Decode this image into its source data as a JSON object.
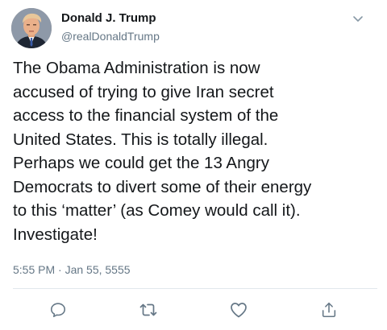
{
  "author": {
    "display_name": "Donald J. Trump",
    "handle": "@realDonaldTrump",
    "avatar_icon": "profile-photo"
  },
  "tweet": {
    "text": "The Obama Administration is now\naccused of trying to give Iran secret\naccess to the financial system of the\nUnited States. This is totally illegal.\nPerhaps we could get the 13 Angry\nDemocrats to divert some of their energy\nto this ‘matter’ (as Comey would call it).\nInvestigate!",
    "timestamp": "5:55 PM · Jan 55, 5555"
  },
  "actions": [
    {
      "name": "reply",
      "icon": "speech-bubble-icon"
    },
    {
      "name": "retweet",
      "icon": "retweet-arrows-icon"
    },
    {
      "name": "like",
      "icon": "heart-icon"
    },
    {
      "name": "share",
      "icon": "share-upload-icon"
    }
  ],
  "colors": {
    "text_primary": "#14171a",
    "text_secondary": "#657786",
    "icon": "#657786",
    "divider": "#e1e8ed"
  }
}
